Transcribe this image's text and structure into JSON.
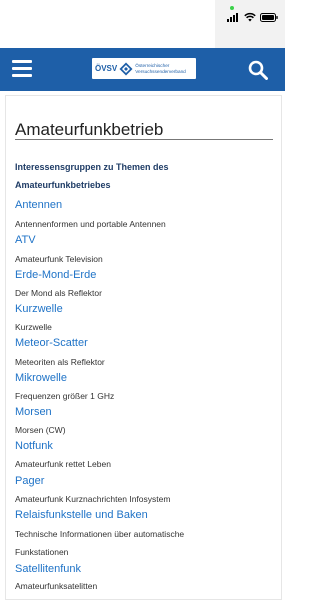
{
  "header": {
    "logo_abbr": "ÖVSV",
    "logo_line1": "Österreichischer",
    "logo_line2": "Versuchssenderverband"
  },
  "page": {
    "title": "Amateurfunkbetrieb",
    "subtitle": "Interessensgruppen zu Themen des Amateurfunkbetriebes"
  },
  "items": [
    {
      "link": "Antennen",
      "desc": "Antennenformen und portable Antennen"
    },
    {
      "link": "ATV",
      "desc": "Amateurfunk Television"
    },
    {
      "link": "Erde-Mond-Erde",
      "desc": "Der Mond als Reflektor"
    },
    {
      "link": "Kurzwelle",
      "desc": "Kurzwelle"
    },
    {
      "link": "Meteor-Scatter",
      "desc": "Meteoriten als Reflektor"
    },
    {
      "link": "Mikrowelle",
      "desc": "Frequenzen größer 1 GHz"
    },
    {
      "link": "Morsen",
      "desc": "Morsen (CW)"
    },
    {
      "link": "Notfunk",
      "desc": "Amateurfunk rettet Leben"
    },
    {
      "link": "Pager",
      "desc": "Amateurfunk Kurznachrichten Infosystem"
    },
    {
      "link": "Relaisfunkstelle und Baken",
      "desc": "Technische Informationen über automatische",
      "desc2": "Funkstationen"
    },
    {
      "link": "Satellitenfunk",
      "desc": "Amateurfunksatelitten"
    }
  ],
  "colors": {
    "header_bg": "#1e5fa8",
    "link": "#1f73c7",
    "subtitle": "#1f3c66"
  },
  "icons": [
    "signal-icon",
    "wifi-icon",
    "battery-icon",
    "menu-icon",
    "search-icon",
    "ovsv-logo-icon"
  ]
}
